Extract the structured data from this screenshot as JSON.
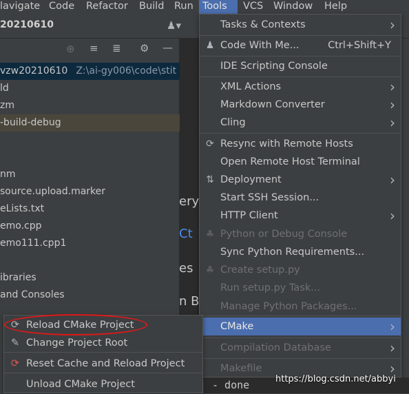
{
  "menubar": [
    "lavigate",
    "Code",
    "Refactor",
    "Build",
    "Run",
    "Tools",
    "VCS",
    "Window",
    "Help"
  ],
  "project_title": "20210610",
  "tree": [
    {
      "label": "vzw20210610",
      "path": "Z:\\ai-gy006\\code\\stit"
    },
    {
      "label": "ld"
    },
    {
      "label": "zm"
    },
    {
      "label": "-build-debug"
    },
    {
      "label": ""
    },
    {
      "label": ""
    },
    {
      "label": "nm"
    },
    {
      "label": "source.upload.marker"
    },
    {
      "label": "eLists.txt"
    },
    {
      "label": "emo.cpp"
    },
    {
      "label": "emo111.cpp1"
    },
    {
      "label": ""
    },
    {
      "label": "ibraries"
    },
    {
      "label": "and Consoles"
    }
  ],
  "editor_fragments": [
    "ery",
    "Ct",
    "es",
    "n B"
  ],
  "tools_menu": {
    "items": [
      {
        "label": "Tasks & Contexts",
        "submenu": true
      },
      {
        "label": "Code With Me...",
        "shortcut": "Ctrl+Shift+Y",
        "icon": "users-icon"
      },
      {
        "label": "IDE Scripting Console"
      },
      {
        "label": "XML Actions",
        "submenu": true
      },
      {
        "label": "Markdown Converter",
        "submenu": true
      },
      {
        "label": "Cling",
        "submenu": true
      },
      {
        "label": "Resync with Remote Hosts",
        "icon": "refresh-icon"
      },
      {
        "label": "Open Remote Host Terminal"
      },
      {
        "label": "Deployment",
        "submenu": true,
        "icon": "transfer-icon"
      },
      {
        "label": "Start SSH Session..."
      },
      {
        "label": "HTTP Client",
        "submenu": true
      },
      {
        "label": "Python or Debug Console",
        "disabled": true,
        "icon": "python-icon"
      },
      {
        "label": "Sync Python Requirements..."
      },
      {
        "label": "Create setup.py",
        "disabled": true,
        "icon": "python-icon"
      },
      {
        "label": "Run setup.py Task...",
        "disabled": true
      },
      {
        "label": "Manage Python Packages...",
        "disabled": true
      },
      {
        "label": "CMake",
        "submenu": true,
        "selected": true
      },
      {
        "label": "Compilation Database",
        "disabled": true,
        "submenu": true
      },
      {
        "label": "Makefile",
        "disabled": true,
        "submenu": true
      }
    ]
  },
  "cmake_submenu": [
    {
      "label": "Reload CMake Project",
      "icon": "reload-icon"
    },
    {
      "label": "Change Project Root",
      "icon": "folder-edit-icon"
    },
    {
      "label": "Reset Cache and Reload Project",
      "icon": "reset-reload-icon"
    },
    {
      "label": "Unload CMake Project"
    }
  ],
  "console_text": "-  done",
  "watermark": "https://blog.csdn.net/abbyi",
  "colors": {
    "accent": "#4b6eaf",
    "annotation": "#e01818",
    "selection": "#0d293e"
  }
}
